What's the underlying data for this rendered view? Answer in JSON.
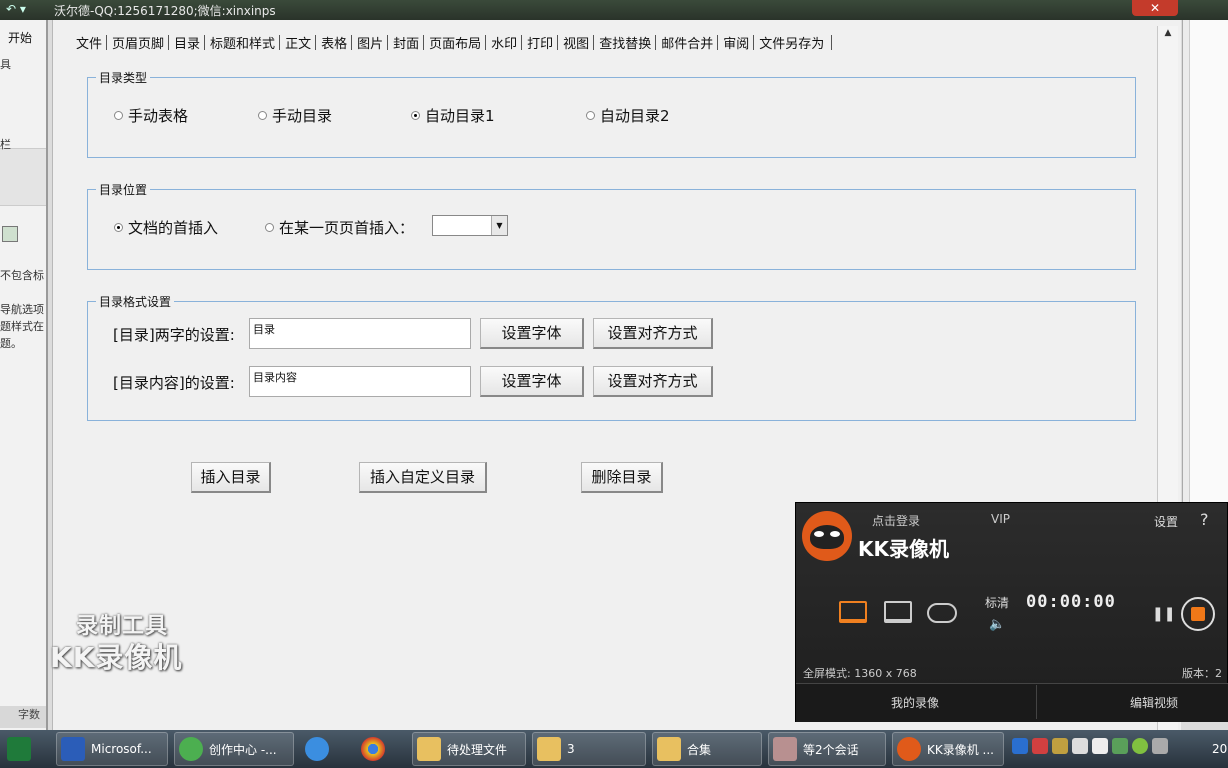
{
  "window": {
    "title": "沃尔德-QQ:1256171280;微信:xinxinps",
    "close_glyph": "✕"
  },
  "background_word": {
    "start_tab": "开始",
    "fragments": [
      "具",
      "栏",
      "不包含标",
      "导航选项",
      "题样式在",
      "题。"
    ],
    "bottom_tab": "字数"
  },
  "menu": {
    "items": [
      "文件",
      "页眉页脚",
      "目录",
      "标题和样式",
      "正文",
      "表格",
      "图片",
      "封面",
      "页面布局",
      "水印",
      "打印",
      "视图",
      "查找替换",
      "邮件合并",
      "审阅",
      "文件另存为"
    ],
    "active_index": 2
  },
  "toc_type": {
    "legend": "目录类型",
    "options": [
      "手动表格",
      "手动目录",
      "自动目录1",
      "自动目录2"
    ],
    "selected_index": 2
  },
  "toc_position": {
    "legend": "目录位置",
    "option_doc_start": "文档的首插入",
    "option_page_start": "在某一页页首插入：",
    "selected": "文档的首插入",
    "page_select_value": ""
  },
  "toc_format": {
    "legend": "目录格式设置",
    "title_label": "[目录]两字的设置:",
    "title_value": "目录",
    "content_label": "[目录内容]的设置:",
    "content_value": "目录内容",
    "set_font": "设置字体",
    "set_align": "设置对齐方式"
  },
  "actions": {
    "insert_toc": "插入目录",
    "insert_custom_toc": "插入自定义目录",
    "delete_toc": "删除目录"
  },
  "watermark": {
    "line1": "录制工具",
    "line2": "KK录像机"
  },
  "kk_recorder": {
    "login": "点击登录",
    "vip": "VIP",
    "settings": "设置",
    "help": "?",
    "brand": "KK录像机",
    "quality": "标清",
    "timer": "00:00:00",
    "fullscreen_mode": "全屏模式: 1360 x 768",
    "version_label": "版本：2",
    "my_recordings": "我的录像",
    "edit_video": "编辑视频",
    "accent": "#f08020"
  },
  "taskbar": {
    "tasks": [
      "Microsof...",
      "创作中心 -...",
      "",
      "",
      "待处理文件",
      "3",
      "合集",
      "等2个会话",
      "KK录像机 ..."
    ],
    "clock": "20"
  }
}
